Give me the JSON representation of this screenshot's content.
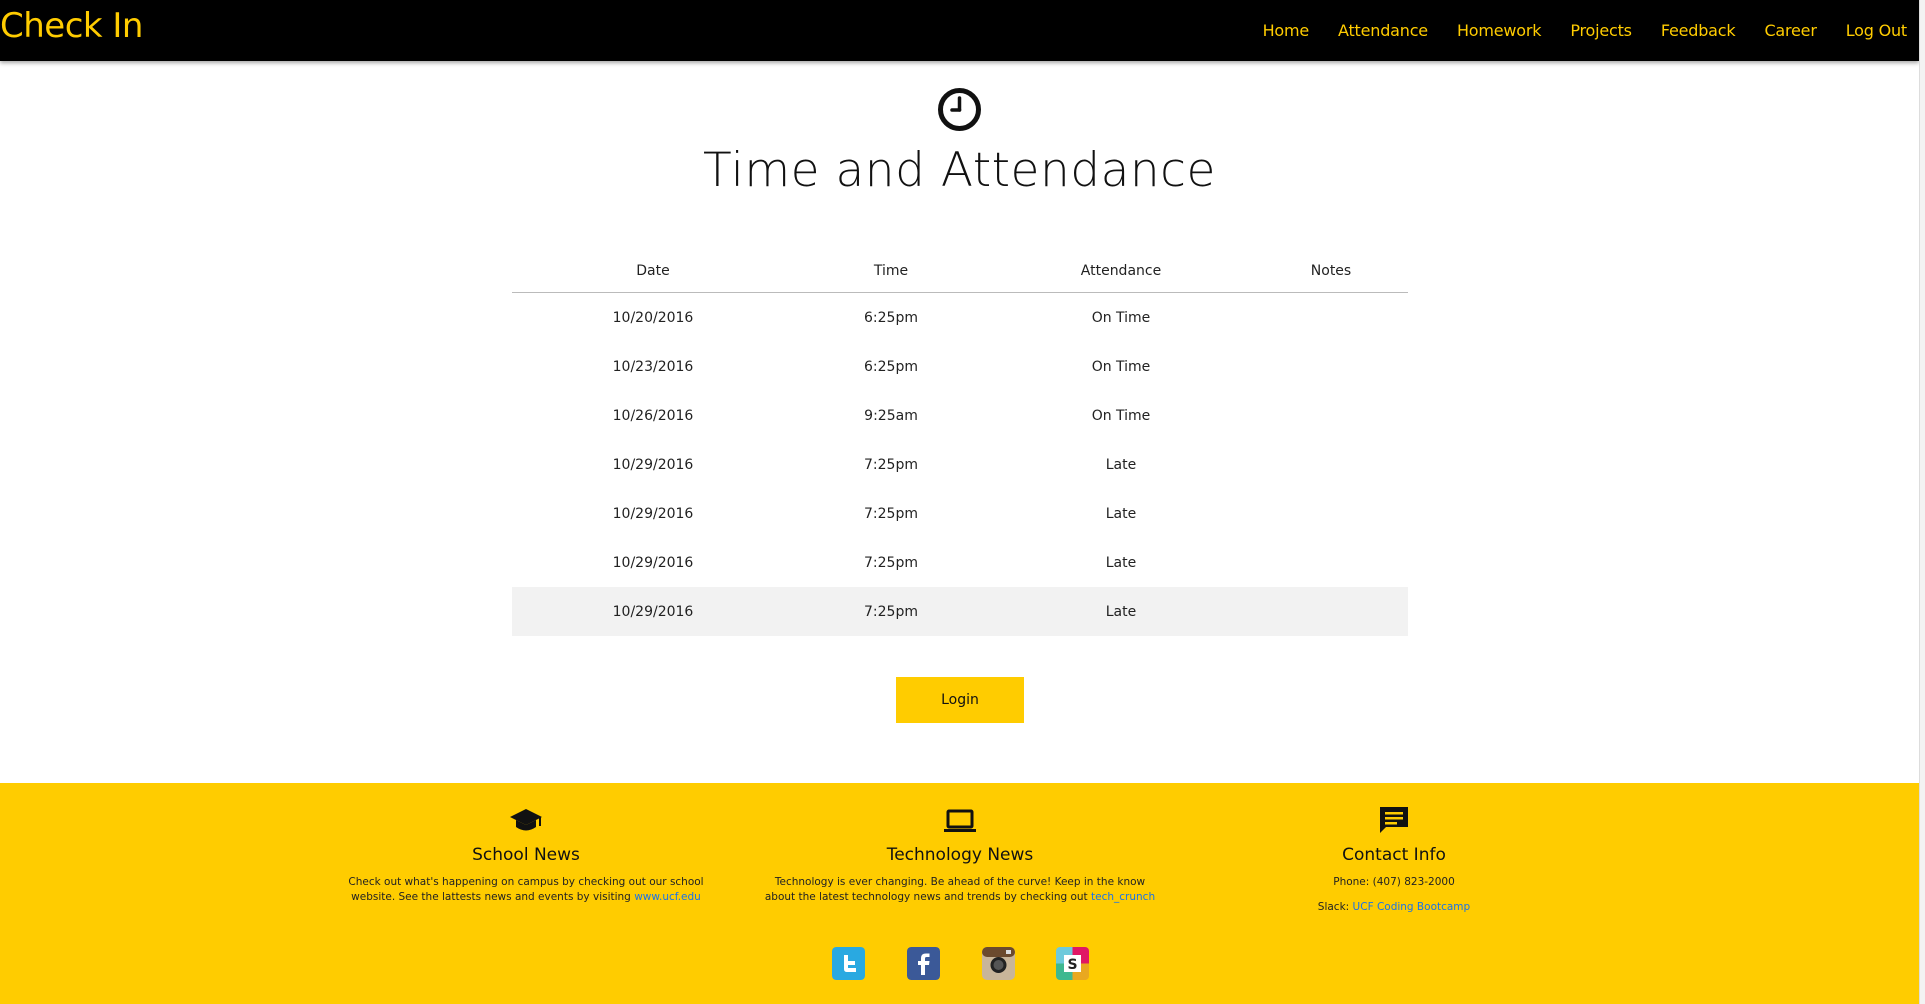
{
  "navbar": {
    "brand": "Check In",
    "links": [
      "Home",
      "Attendance",
      "Homework",
      "Projects",
      "Feedback",
      "Career",
      "Log Out"
    ]
  },
  "header": {
    "icon": "clock-icon",
    "title": "Time and Attendance"
  },
  "table": {
    "columns": [
      "Date",
      "Time",
      "Attendance",
      "Notes"
    ],
    "rows": [
      {
        "date": "10/20/2016",
        "time": "6:25pm",
        "attendance": "On Time",
        "notes": ""
      },
      {
        "date": "10/23/2016",
        "time": "6:25pm",
        "attendance": "On Time",
        "notes": ""
      },
      {
        "date": "10/26/2016",
        "time": "9:25am",
        "attendance": "On Time",
        "notes": ""
      },
      {
        "date": "10/29/2016",
        "time": "7:25pm",
        "attendance": "Late",
        "notes": ""
      },
      {
        "date": "10/29/2016",
        "time": "7:25pm",
        "attendance": "Late",
        "notes": ""
      },
      {
        "date": "10/29/2016",
        "time": "7:25pm",
        "attendance": "Late",
        "notes": ""
      },
      {
        "date": "10/29/2016",
        "time": "7:25pm",
        "attendance": "Late",
        "notes": ""
      }
    ]
  },
  "login_label": "Login",
  "footer": {
    "school": {
      "icon": "graduation-cap-icon",
      "heading": "School News",
      "text_line1": "Check out what's happening on campus by checking out our school",
      "text_line2": "website. See the lattests news and events by visiting",
      "link": "www.ucf.edu"
    },
    "tech": {
      "icon": "laptop-icon",
      "heading": "Technology News",
      "text_line1": "Technology is ever changing. Be ahead of the curve! Keep in the know",
      "text_line2": "about the latest technology news and trends by checking out",
      "link": "tech_crunch"
    },
    "contact": {
      "icon": "chat-icon",
      "heading": "Contact Info",
      "phone": "Phone: (407) 823-2000",
      "slack_label": "Slack:",
      "slack_link": "UCF Coding Bootcamp"
    },
    "social": [
      "twitter-icon",
      "facebook-icon",
      "instagram-icon",
      "slack-icon"
    ]
  },
  "colors": {
    "accent": "#FFCC00",
    "navbar_bg": "#000000",
    "link": "#1a73e8"
  }
}
